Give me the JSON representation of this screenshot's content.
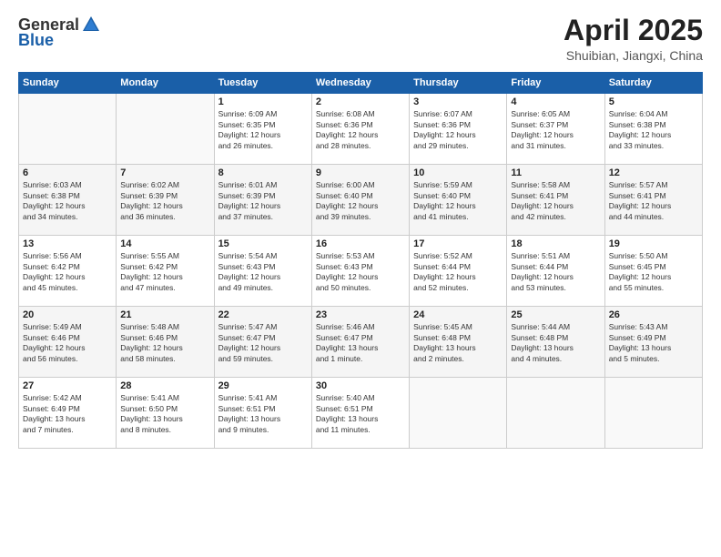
{
  "logo": {
    "general": "General",
    "blue": "Blue"
  },
  "title": "April 2025",
  "subtitle": "Shuibian, Jiangxi, China",
  "days_header": [
    "Sunday",
    "Monday",
    "Tuesday",
    "Wednesday",
    "Thursday",
    "Friday",
    "Saturday"
  ],
  "weeks": [
    [
      {
        "day": "",
        "info": ""
      },
      {
        "day": "",
        "info": ""
      },
      {
        "day": "1",
        "info": "Sunrise: 6:09 AM\nSunset: 6:35 PM\nDaylight: 12 hours\nand 26 minutes."
      },
      {
        "day": "2",
        "info": "Sunrise: 6:08 AM\nSunset: 6:36 PM\nDaylight: 12 hours\nand 28 minutes."
      },
      {
        "day": "3",
        "info": "Sunrise: 6:07 AM\nSunset: 6:36 PM\nDaylight: 12 hours\nand 29 minutes."
      },
      {
        "day": "4",
        "info": "Sunrise: 6:05 AM\nSunset: 6:37 PM\nDaylight: 12 hours\nand 31 minutes."
      },
      {
        "day": "5",
        "info": "Sunrise: 6:04 AM\nSunset: 6:38 PM\nDaylight: 12 hours\nand 33 minutes."
      }
    ],
    [
      {
        "day": "6",
        "info": "Sunrise: 6:03 AM\nSunset: 6:38 PM\nDaylight: 12 hours\nand 34 minutes."
      },
      {
        "day": "7",
        "info": "Sunrise: 6:02 AM\nSunset: 6:39 PM\nDaylight: 12 hours\nand 36 minutes."
      },
      {
        "day": "8",
        "info": "Sunrise: 6:01 AM\nSunset: 6:39 PM\nDaylight: 12 hours\nand 37 minutes."
      },
      {
        "day": "9",
        "info": "Sunrise: 6:00 AM\nSunset: 6:40 PM\nDaylight: 12 hours\nand 39 minutes."
      },
      {
        "day": "10",
        "info": "Sunrise: 5:59 AM\nSunset: 6:40 PM\nDaylight: 12 hours\nand 41 minutes."
      },
      {
        "day": "11",
        "info": "Sunrise: 5:58 AM\nSunset: 6:41 PM\nDaylight: 12 hours\nand 42 minutes."
      },
      {
        "day": "12",
        "info": "Sunrise: 5:57 AM\nSunset: 6:41 PM\nDaylight: 12 hours\nand 44 minutes."
      }
    ],
    [
      {
        "day": "13",
        "info": "Sunrise: 5:56 AM\nSunset: 6:42 PM\nDaylight: 12 hours\nand 45 minutes."
      },
      {
        "day": "14",
        "info": "Sunrise: 5:55 AM\nSunset: 6:42 PM\nDaylight: 12 hours\nand 47 minutes."
      },
      {
        "day": "15",
        "info": "Sunrise: 5:54 AM\nSunset: 6:43 PM\nDaylight: 12 hours\nand 49 minutes."
      },
      {
        "day": "16",
        "info": "Sunrise: 5:53 AM\nSunset: 6:43 PM\nDaylight: 12 hours\nand 50 minutes."
      },
      {
        "day": "17",
        "info": "Sunrise: 5:52 AM\nSunset: 6:44 PM\nDaylight: 12 hours\nand 52 minutes."
      },
      {
        "day": "18",
        "info": "Sunrise: 5:51 AM\nSunset: 6:44 PM\nDaylight: 12 hours\nand 53 minutes."
      },
      {
        "day": "19",
        "info": "Sunrise: 5:50 AM\nSunset: 6:45 PM\nDaylight: 12 hours\nand 55 minutes."
      }
    ],
    [
      {
        "day": "20",
        "info": "Sunrise: 5:49 AM\nSunset: 6:46 PM\nDaylight: 12 hours\nand 56 minutes."
      },
      {
        "day": "21",
        "info": "Sunrise: 5:48 AM\nSunset: 6:46 PM\nDaylight: 12 hours\nand 58 minutes."
      },
      {
        "day": "22",
        "info": "Sunrise: 5:47 AM\nSunset: 6:47 PM\nDaylight: 12 hours\nand 59 minutes."
      },
      {
        "day": "23",
        "info": "Sunrise: 5:46 AM\nSunset: 6:47 PM\nDaylight: 13 hours\nand 1 minute."
      },
      {
        "day": "24",
        "info": "Sunrise: 5:45 AM\nSunset: 6:48 PM\nDaylight: 13 hours\nand 2 minutes."
      },
      {
        "day": "25",
        "info": "Sunrise: 5:44 AM\nSunset: 6:48 PM\nDaylight: 13 hours\nand 4 minutes."
      },
      {
        "day": "26",
        "info": "Sunrise: 5:43 AM\nSunset: 6:49 PM\nDaylight: 13 hours\nand 5 minutes."
      }
    ],
    [
      {
        "day": "27",
        "info": "Sunrise: 5:42 AM\nSunset: 6:49 PM\nDaylight: 13 hours\nand 7 minutes."
      },
      {
        "day": "28",
        "info": "Sunrise: 5:41 AM\nSunset: 6:50 PM\nDaylight: 13 hours\nand 8 minutes."
      },
      {
        "day": "29",
        "info": "Sunrise: 5:41 AM\nSunset: 6:51 PM\nDaylight: 13 hours\nand 9 minutes."
      },
      {
        "day": "30",
        "info": "Sunrise: 5:40 AM\nSunset: 6:51 PM\nDaylight: 13 hours\nand 11 minutes."
      },
      {
        "day": "",
        "info": ""
      },
      {
        "day": "",
        "info": ""
      },
      {
        "day": "",
        "info": ""
      }
    ]
  ]
}
